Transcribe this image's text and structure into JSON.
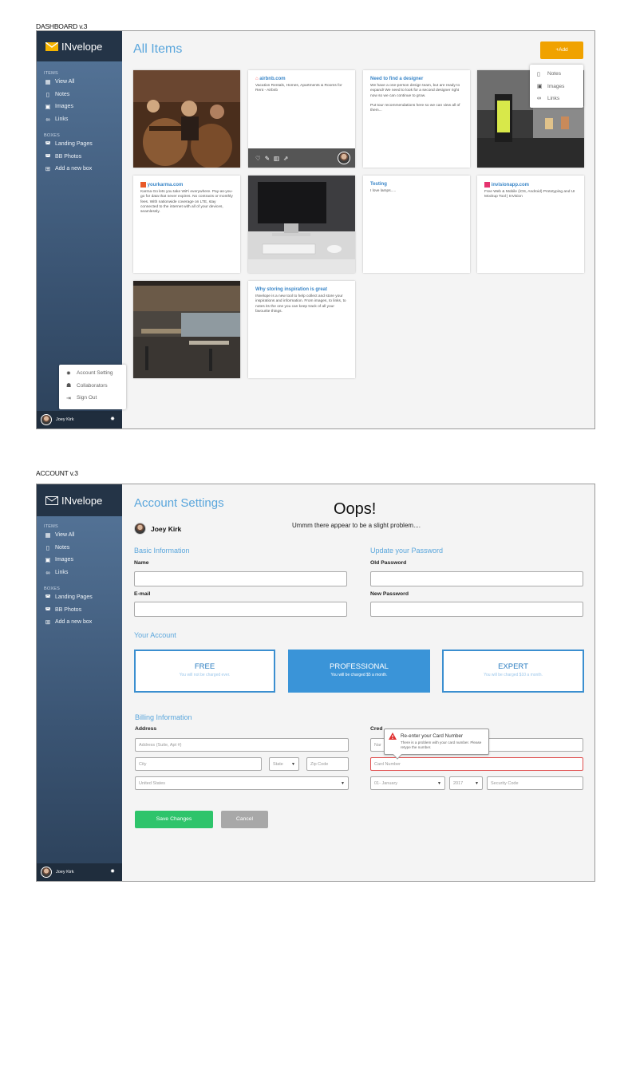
{
  "dashboard": {
    "section_label": "DASHBOARD v.3",
    "logo_text": "INvelope",
    "title": "All Items",
    "add_button": "+Add",
    "add_menu": [
      "Notes",
      "Images",
      "Links"
    ],
    "sidebar": {
      "items_header": "ITEMS",
      "items": [
        {
          "icon": "grid-icon",
          "label": "View All"
        },
        {
          "icon": "note-icon",
          "label": "Notes"
        },
        {
          "icon": "image-icon",
          "label": "Images"
        },
        {
          "icon": "link-icon",
          "label": "Links"
        }
      ],
      "boxes_header": "BOXES",
      "boxes": [
        {
          "icon": "box-icon",
          "label": "Landing Pages"
        },
        {
          "icon": "box-icon",
          "label": "BB Photos"
        },
        {
          "icon": "plus-square-icon",
          "label": "Add a new box"
        }
      ]
    },
    "user_menu": [
      "Account Setting",
      "Collaborators",
      "Sign Out"
    ],
    "user_name": "Joey Kirk",
    "cards": {
      "airbnb": {
        "title": "airbnb.com",
        "body": "Vacation Rentals, Homes, Apartments & Rooms for Rent - Airbnb"
      },
      "designer": {
        "title": "Need to find a designer",
        "body1": "We have a one-person design team, but are ready to expand! We need to look for a second designer right now so we can continue to grow.",
        "body2": "Put tour recommendations here so we can view all of them..."
      },
      "yourkarma": {
        "title": "yourkarma.com",
        "body": "Karma Go lets you take WiFi everywhere. Pay-as-you-go for data that never expires. No contracts or monthly fees. With nationwide coverage on LTE, stay connected to the internet with all of your devices, seamlessly."
      },
      "testing": {
        "title": "Testing",
        "body": "I love lamps....."
      },
      "invision": {
        "title": "invisionapp.com",
        "body": "Free Web & Mobile (iOS, Android) Prototyping and UI Mockup Tool | InVision"
      },
      "inspiration": {
        "title": "Why storing inspiration is great",
        "body": "INvelope is a new tool to help collect and store your inspirations and information. From images, to links, to notes its the one you can keep track of all your favourite things."
      }
    }
  },
  "account": {
    "section_label": "ACCOUNT v.3",
    "logo_text": "INvelope",
    "title": "Account Settings",
    "oops_title": "Oops!",
    "oops_sub": "Ummm there appear to be  a slight problem....",
    "user_name": "Joey Kirk",
    "basic_info": "Basic Information",
    "name_label": "Name",
    "email_label": "E-mail",
    "update_password": "Update your Password",
    "old_password": "Old Password",
    "new_password": "New Password",
    "your_account": "Your Account",
    "plans": [
      {
        "name": "FREE",
        "desc": "You will not be charged ever."
      },
      {
        "name": "PROFESSIONAL",
        "desc": "You will be charged $5 a month."
      },
      {
        "name": "EXPERT",
        "desc": "You will be charged $10 a month."
      }
    ],
    "billing_info": "Billing Information",
    "address_label": "Address",
    "address_placeholder": "Address (Suite, Apt #)",
    "city_placeholder": "City",
    "state_value": "State",
    "zip_placeholder": "Zip Code",
    "country_value": "United States",
    "credit_label": "Cred",
    "name_placeholder": "Nar",
    "card_placeholder": "Card Number",
    "month_value": "01- January",
    "year_value": "2017",
    "security_placeholder": "Security Code",
    "tooltip_title": "Re-enter your Card Number",
    "tooltip_body": "There is a problem with your card number. Please retype the number.",
    "save_button": "Save Changes",
    "cancel_button": "Cancel"
  },
  "colors": {
    "accent": "#5aa6dc",
    "add": "#f0a200",
    "save": "#2ec46b",
    "cancel": "#a8a8a8",
    "error": "#e05050"
  }
}
